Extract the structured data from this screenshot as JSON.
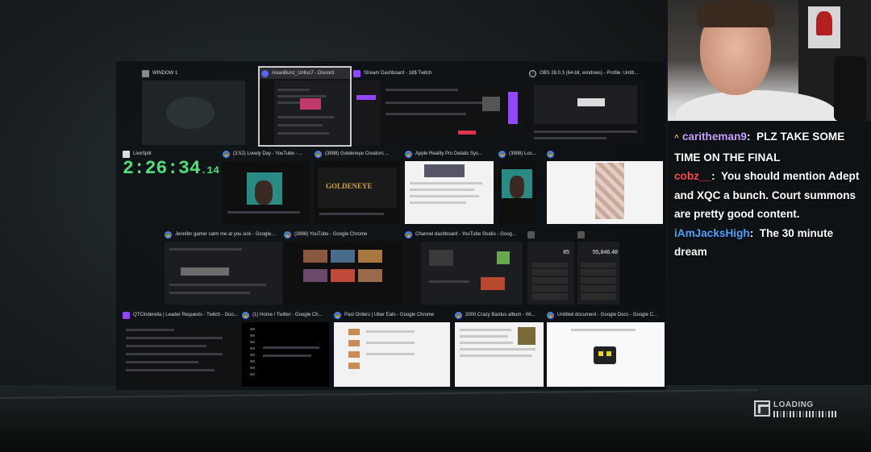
{
  "windows": {
    "row1": [
      {
        "title": "WINDOW 1"
      },
      {
        "title": "AsianBunz_Unlisc7 - Discord"
      },
      {
        "title": "Stream Dashboard - 18$ Twitch"
      },
      {
        "title": "OBS 28.0.3 (64-bit, windows) - Profile: Untitl..."
      }
    ],
    "row2": [
      {
        "title": "LiveSplit"
      },
      {
        "title": "(3:52) Lovely Day - YouTube - ..."
      },
      {
        "title": "(3998) Goldeneye Creators ..."
      },
      {
        "title": "Apple Reality Pro Details Sys..."
      },
      {
        "title": "(3998) Los..."
      },
      {
        "title": ""
      }
    ],
    "row3": [
      {
        "title": "Jennifer gamer calm me at you sick - Google..."
      },
      {
        "title": "(3998) YouTube - Google Chrome"
      },
      {
        "title": "Channel dashboard - YouTube Studio - Goog..."
      },
      {
        "title": ""
      },
      {
        "title": ""
      }
    ],
    "row4": [
      {
        "title": "QTCinderella | Leader Requests - Twitch - Goo..."
      },
      {
        "title": "(1) Home / Twitter - Google Ch..."
      },
      {
        "title": "Past Orders | Uber Eats - Google Chrome"
      },
      {
        "title": "2000 Crazy Bardus album - Wi..."
      },
      {
        "title": "Untitled document - Google Docs - Google C..."
      }
    ]
  },
  "timer": {
    "main": "2:26:34",
    "fraction": ".14"
  },
  "calc": {
    "a": "85",
    "b": "55,846.48"
  },
  "thumb_text": {
    "goldeneye": "GOLDENEYE"
  },
  "chat": [
    {
      "badge": "^",
      "user": "caritheman9",
      "user_color": "#c9a0ff",
      "text": "PLZ TAKE SOME TIME ON THE FINAL"
    },
    {
      "badge": "",
      "user": "cobz__",
      "user_color": "#ff4a4a",
      "text": "You should mention Adept and XQC a bunch. Court summons are pretty good content."
    },
    {
      "badge": "",
      "user": "iAmJacksHigh",
      "user_color": "#4aa3ff",
      "text": "The 30 minute dream"
    }
  ],
  "loading": {
    "label": "LOADING"
  }
}
